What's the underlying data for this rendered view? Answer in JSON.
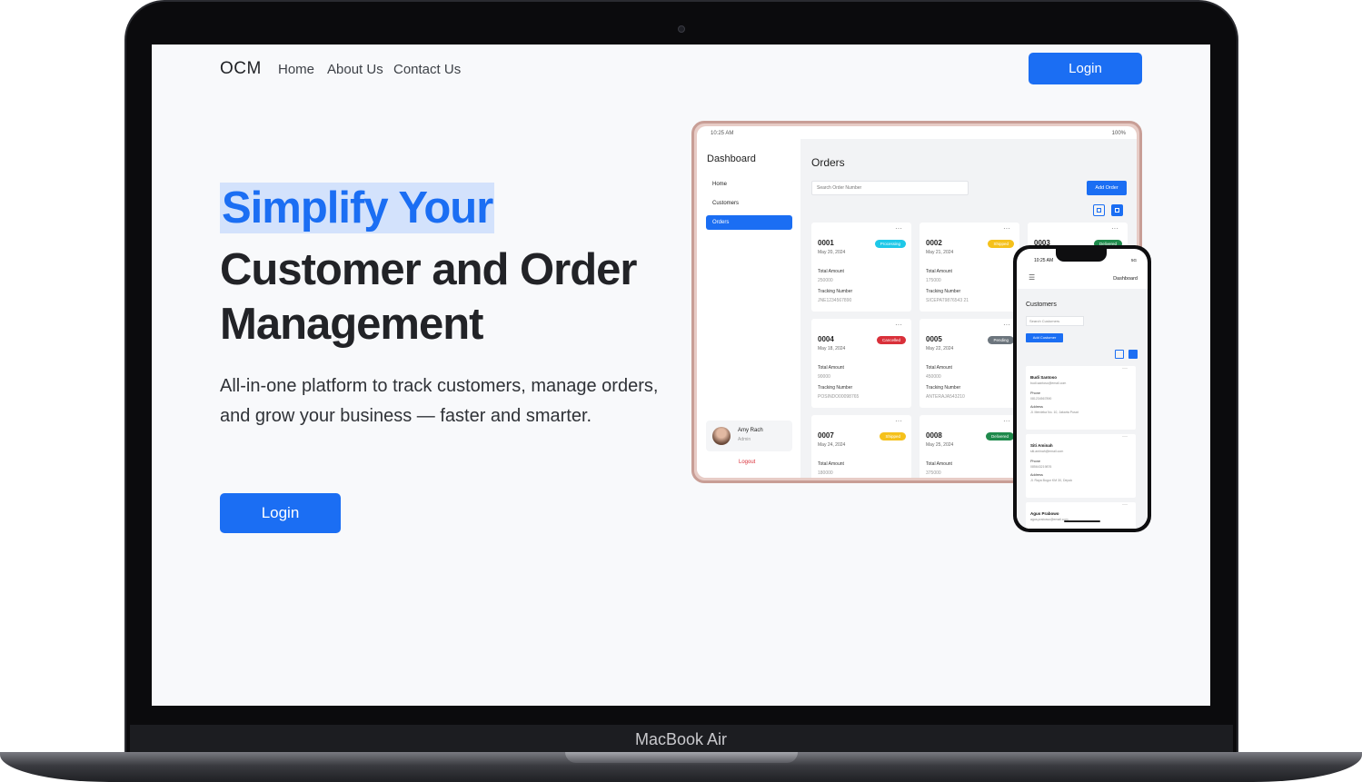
{
  "device": {
    "chin_label": "MacBook Air"
  },
  "nav": {
    "brand": "OCM",
    "links": [
      "Home",
      "About Us",
      "Contact Us"
    ],
    "login_label": "Login"
  },
  "hero": {
    "title_line1": "Simplify Your",
    "title_line2": "Customer and Order",
    "title_line3": "Management",
    "subtitle": "All-in-one platform to track customers, manage orders, and grow your business — faster and smarter.",
    "login_label": "Login"
  },
  "tablet": {
    "status_time": "10:25 AM",
    "status_battery": "100%",
    "sidebar_title": "Dashboard",
    "nav_items": [
      "Home",
      "Customers",
      "Orders"
    ],
    "active_nav": "Orders",
    "user_name": "Amy Rach",
    "user_role": "Admin",
    "logout_label": "Logout",
    "page_title": "Orders",
    "search_placeholder": "Search Order Number",
    "add_label": "Add Order",
    "total_amount_label": "Total Amount",
    "tracking_label": "Tracking Number",
    "orders": [
      {
        "id": "0001",
        "date": "May 20, 2024",
        "status": "Processing",
        "amount": "250000",
        "tracking": "JNE1234567890"
      },
      {
        "id": "0002",
        "date": "May 21, 2024",
        "status": "Shipped",
        "amount": "175000",
        "tracking": "SICEPAT9876543 21"
      },
      {
        "id": "0003",
        "date": "",
        "status": "Delivered",
        "amount": "",
        "tracking": ""
      },
      {
        "id": "0004",
        "date": "May 18, 2024",
        "status": "Cancelled",
        "amount": "90000",
        "tracking": "POSINDO00098765"
      },
      {
        "id": "0005",
        "date": "May 22, 2024",
        "status": "Pending",
        "amount": "450000",
        "tracking": "ANTERAJA543210"
      },
      {
        "id": "0007",
        "date": "May 24, 2024",
        "status": "Shipped",
        "amount": "180000",
        "tracking": ""
      },
      {
        "id": "0008",
        "date": "May 25, 2024",
        "status": "Delivered",
        "amount": "375000",
        "tracking": ""
      }
    ],
    "status_colors": {
      "Processing": "#1ec8e8",
      "Shipped": "#f5c11b",
      "Delivered": "#1f8a4c",
      "Cancelled": "#d9303a",
      "Pending": "#6c757d"
    }
  },
  "phone": {
    "status_time": "10:25 AM",
    "status_signal": "5G",
    "header_title": "Dashboard",
    "page_title": "Customers",
    "search_placeholder": "Search Customers",
    "add_label": "Add Customer",
    "phone_label": "Phone",
    "address_label": "Address",
    "customers": [
      {
        "name": "Budi Santoso",
        "email": "budi.santoso@email.com",
        "phone": "081234567890",
        "address": "Jl. Merdeka No. 10, Jakarta Pusat"
      },
      {
        "name": "Siti Aminah",
        "email": "siti.aminah@email.com",
        "phone": "085643219876",
        "address": "Jl. Raya Bogor KM 30, Depok"
      },
      {
        "name": "Agus Prabowo",
        "email": "agus.prabowo@email.com",
        "phone": "",
        "address": ""
      }
    ]
  },
  "accent": "#1b6ef3"
}
